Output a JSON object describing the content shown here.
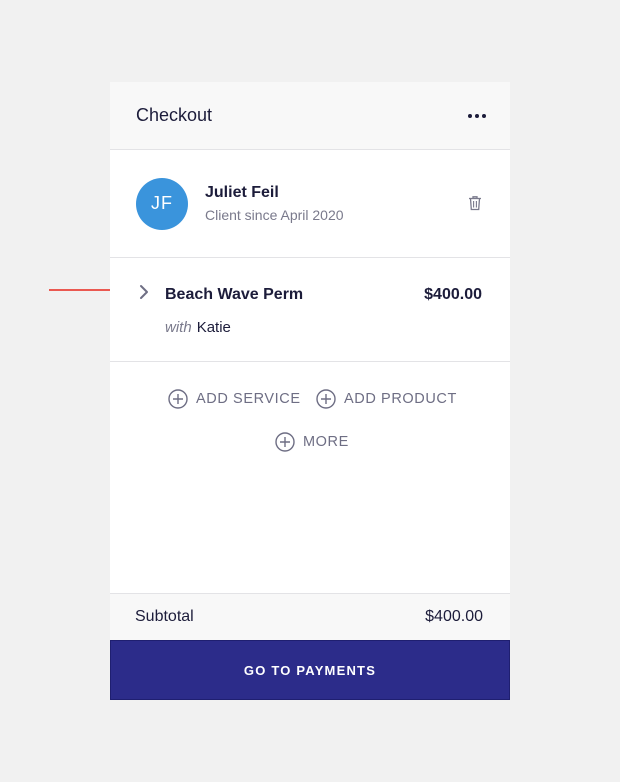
{
  "header": {
    "title": "Checkout",
    "menu_icon": "more-horizontal-icon"
  },
  "client": {
    "initials": "JF",
    "name": "Juliet Feil",
    "since": "Client since April 2020",
    "avatar_color": "#3a94dc",
    "delete_icon": "trash-icon"
  },
  "service": {
    "name": "Beach Wave Perm",
    "price": "$400.00",
    "with_label": "with",
    "staff": "Katie",
    "expand_icon": "chevron-right-icon"
  },
  "actions": {
    "add_service": "ADD SERVICE",
    "add_product": "ADD PRODUCT",
    "more": "MORE"
  },
  "summary": {
    "subtotal_label": "Subtotal",
    "subtotal_value": "$400.00"
  },
  "cta": {
    "label": "GO TO PAYMENTS",
    "color": "#2c2c8a"
  },
  "annotation": {
    "arrow_color": "#e8261b"
  }
}
